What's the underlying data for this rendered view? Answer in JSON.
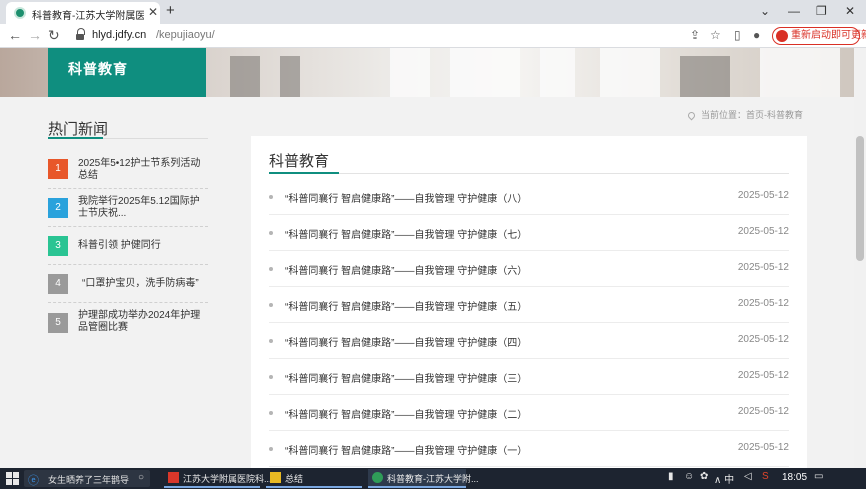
{
  "browser": {
    "tab_title": "科普教育-江苏大学附属医院护理",
    "tab_close": "✕",
    "new_tab": "+",
    "url_domain": "hlyd.jdfy.cn",
    "url_path": "/kepujiaoyu/",
    "restart_label": "重新启动即可更新",
    "win_controls": [
      "⌄",
      "—",
      "❐",
      "✕"
    ]
  },
  "banner": {
    "title": "科普教育"
  },
  "sidebar": {
    "title": "热门新闻",
    "items": [
      {
        "num": "1",
        "text": "2025年5•12护士节系列活动总结",
        "color": "#e8572a"
      },
      {
        "num": "2",
        "text": "我院举行2025年5.12国际护士节庆祝...",
        "color": "#2aa2dc"
      },
      {
        "num": "3",
        "text": "科普引领 护健同行",
        "color": "#2ac493"
      },
      {
        "num": "4",
        "text": "“口罩护宝贝，洗手防病毒”",
        "color": "#9a9a9a"
      },
      {
        "num": "5",
        "text": "护理部成功举办2024年护理品管圈比赛",
        "color": "#9a9a9a"
      }
    ]
  },
  "breadcrumb": {
    "text": "当前位置：首页-科普教育"
  },
  "main": {
    "title": "科普教育",
    "articles": [
      {
        "title": "“科普同襄行 智启健康路”——自我管理 守护健康（八）",
        "date": "2025-05-12"
      },
      {
        "title": "“科普同襄行 智启健康路”——自我管理 守护健康（七）",
        "date": "2025-05-12"
      },
      {
        "title": "“科普同襄行 智启健康路”——自我管理 守护健康（六）",
        "date": "2025-05-12"
      },
      {
        "title": "“科普同襄行 智启健康路”——自我管理 守护健康（五）",
        "date": "2025-05-12"
      },
      {
        "title": "“科普同襄行 智启健康路”——自我管理 守护健康（四）",
        "date": "2025-05-12"
      },
      {
        "title": "“科普同襄行 智启健康路”——自我管理 守护健康（三）",
        "date": "2025-05-12"
      },
      {
        "title": "“科普同襄行 智启健康路”——自我管理 守护健康（二）",
        "date": "2025-05-12"
      },
      {
        "title": "“科普同襄行 智启健康路”——自我管理 守护健康（一）",
        "date": "2025-05-12"
      }
    ]
  },
  "taskbar": {
    "search_text": "女生晒养了三年鹊导",
    "apps": [
      {
        "label": "江苏大学附属医院科...",
        "icon_color": "#d9372a"
      },
      {
        "label": "总结",
        "icon_color": "#e8b923"
      },
      {
        "label": "科普教育-江苏大学附...",
        "icon_color": "#2f9d58"
      }
    ],
    "tray_text": "∧ 中",
    "clock": "18:05"
  },
  "colors": {
    "accent": "#0f8e7f",
    "restart": "#d93025"
  }
}
